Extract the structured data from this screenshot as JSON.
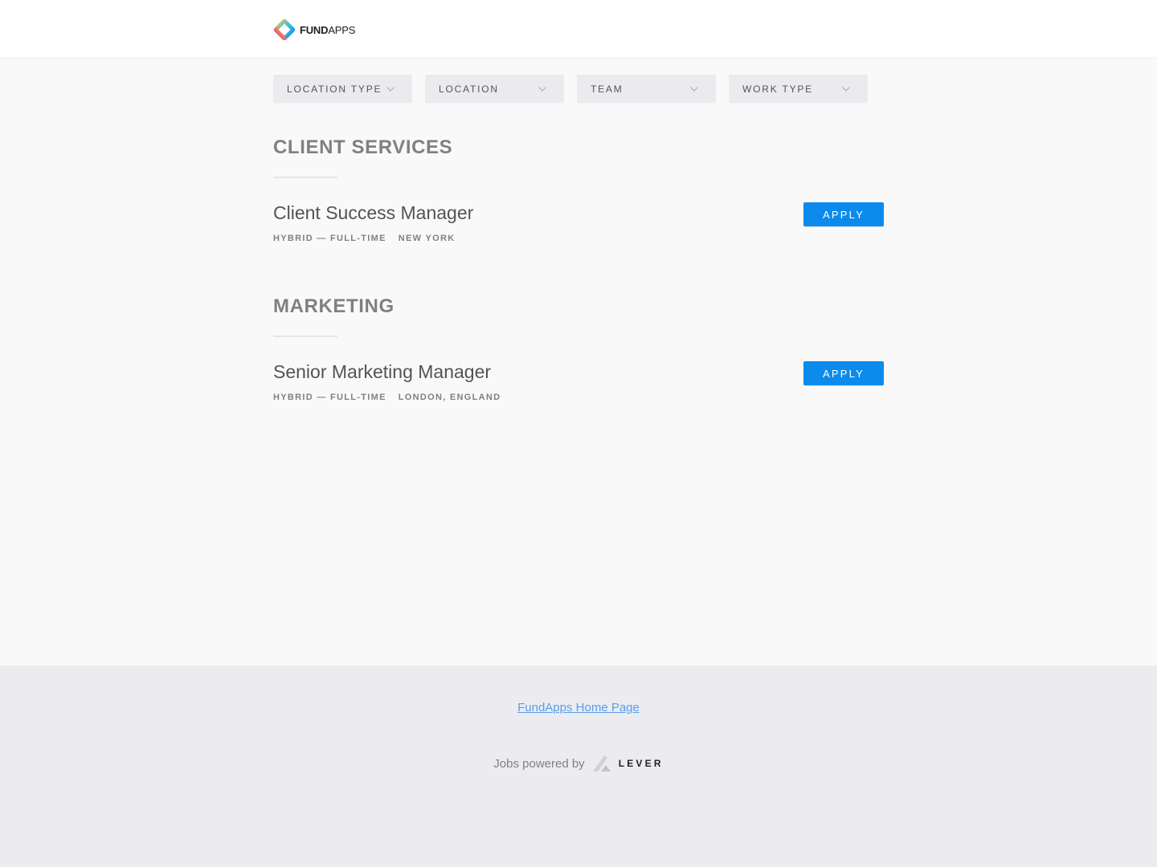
{
  "header": {
    "logo": {
      "bold": "FUND",
      "light": "APPS",
      "alt": "FundApps"
    }
  },
  "filters": [
    {
      "label": "LOCATION TYPE",
      "icon": "chevron-down-icon"
    },
    {
      "label": "LOCATION",
      "icon": "chevron-down-icon"
    },
    {
      "label": "TEAM",
      "icon": "chevron-down-icon"
    },
    {
      "label": "WORK TYPE",
      "icon": "chevron-down-icon"
    }
  ],
  "groups": [
    {
      "title": "CLIENT SERVICES",
      "postings": [
        {
          "title": "Client Success Manager",
          "commitment": "HYBRID — FULL-TIME",
          "location": "NEW YORK",
          "apply_label": "APPLY"
        }
      ]
    },
    {
      "title": "MARKETING",
      "postings": [
        {
          "title": "Senior Marketing Manager",
          "commitment": "HYBRID — FULL-TIME",
          "location": "LONDON, ENGLAND",
          "apply_label": "APPLY"
        }
      ]
    }
  ],
  "footer": {
    "home_link": "FundApps Home Page",
    "powered_by": "Jobs powered by",
    "lever_label": "LEVER"
  },
  "colors": {
    "apply_button": "#0c8bec",
    "link": "#579eee",
    "footer_bg": "#ececf0",
    "page_bg": "#f9f9f9"
  }
}
